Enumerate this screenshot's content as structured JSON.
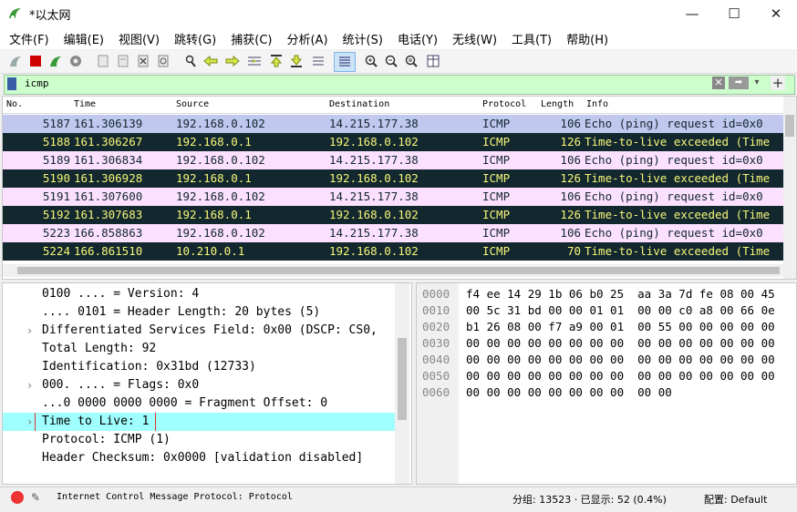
{
  "window": {
    "title": "*以太网",
    "buttons": [
      "—",
      "☐",
      "✕"
    ]
  },
  "menu": [
    "文件(F)",
    "编辑(E)",
    "视图(V)",
    "跳转(G)",
    "捕获(C)",
    "分析(A)",
    "统计(S)",
    "电话(Y)",
    "无线(W)",
    "工具(T)",
    "帮助(H)"
  ],
  "toolbar_icons": [
    "shark-fin-start-icon",
    "stop-icon",
    "restart-icon",
    "options-gear-icon",
    "open-file-icon",
    "save-file-icon",
    "close-file-icon",
    "reload-icon",
    "find-icon",
    "go-back-icon",
    "go-forward-icon",
    "go-to-packet-icon",
    "first-packet-icon",
    "last-packet-icon",
    "autoscroll-icon",
    "colorize-icon",
    "zoom-in-icon",
    "zoom-out-icon",
    "zoom-normal-icon",
    "resize-columns-icon"
  ],
  "filter": {
    "value": "icmp"
  },
  "packet_list": {
    "columns": [
      "No.",
      "Time",
      "Source",
      "Destination",
      "Protocol",
      "Length",
      "Info"
    ],
    "rows": [
      {
        "no": "5187",
        "time": "161.306139",
        "src": "192.168.0.102",
        "dst": "14.215.177.38",
        "proto": "ICMP",
        "len": "106",
        "info": "Echo (ping) request  id=0x0",
        "style": "selected"
      },
      {
        "no": "5188",
        "time": "161.306267",
        "src": "192.168.0.1",
        "dst": "192.168.0.102",
        "proto": "ICMP",
        "len": "126",
        "info": "Time-to-live exceeded (Time",
        "style": "ttl"
      },
      {
        "no": "5189",
        "time": "161.306834",
        "src": "192.168.0.102",
        "dst": "14.215.177.38",
        "proto": "ICMP",
        "len": "106",
        "info": "Echo (ping) request  id=0x0",
        "style": "request"
      },
      {
        "no": "5190",
        "time": "161.306928",
        "src": "192.168.0.1",
        "dst": "192.168.0.102",
        "proto": "ICMP",
        "len": "126",
        "info": "Time-to-live exceeded (Time",
        "style": "ttl"
      },
      {
        "no": "5191",
        "time": "161.307600",
        "src": "192.168.0.102",
        "dst": "14.215.177.38",
        "proto": "ICMP",
        "len": "106",
        "info": "Echo (ping) request  id=0x0",
        "style": "request"
      },
      {
        "no": "5192",
        "time": "161.307683",
        "src": "192.168.0.1",
        "dst": "192.168.0.102",
        "proto": "ICMP",
        "len": "126",
        "info": "Time-to-live exceeded (Time",
        "style": "ttl"
      },
      {
        "no": "5223",
        "time": "166.858863",
        "src": "192.168.0.102",
        "dst": "14.215.177.38",
        "proto": "ICMP",
        "len": "106",
        "info": "Echo (ping) request  id=0x0",
        "style": "request"
      },
      {
        "no": "5224",
        "time": "166.861510",
        "src": "10.210.0.1",
        "dst": "192.168.0.102",
        "proto": "ICMP",
        "len": "70",
        "info": "Time-to-live exceeded (Time",
        "style": "ttl"
      }
    ]
  },
  "details": [
    {
      "text": "0100 .... = Version: 4",
      "expandable": false
    },
    {
      "text": ".... 0101 = Header Length: 20 bytes (5)",
      "expandable": false
    },
    {
      "text": "Differentiated Services Field: 0x00 (DSCP: CS0,",
      "expandable": true
    },
    {
      "text": "Total Length: 92",
      "expandable": false
    },
    {
      "text": "Identification: 0x31bd (12733)",
      "expandable": false
    },
    {
      "text": "000. .... = Flags: 0x0",
      "expandable": true
    },
    {
      "text": "...0 0000 0000 0000 = Fragment Offset: 0",
      "expandable": false
    },
    {
      "text": "Time to Live: 1",
      "expandable": true,
      "highlighted": true
    },
    {
      "text": "Protocol: ICMP (1)",
      "expandable": false
    },
    {
      "text": "Header Checksum: 0x0000 [validation disabled]",
      "expandable": false
    }
  ],
  "hex": {
    "offsets": [
      "0000",
      "0010",
      "0020",
      "0030",
      "0040",
      "0050",
      "0060"
    ],
    "lines": [
      "f4 ee 14 29 1b 06 b0 25  aa 3a 7d fe 08 00 45",
      "00 5c 31 bd 00 00 01 01  00 00 c0 a8 00 66 0e",
      "b1 26 08 00 f7 a9 00 01  00 55 00 00 00 00 00",
      "00 00 00 00 00 00 00 00  00 00 00 00 00 00 00",
      "00 00 00 00 00 00 00 00  00 00 00 00 00 00 00",
      "00 00 00 00 00 00 00 00  00 00 00 00 00 00 00",
      "00 00 00 00 00 00 00 00  00 00"
    ]
  },
  "status": {
    "protocol_text": "Internet Control Message Protocol: Protocol",
    "packets": "分组: 13523 · 已显示: 52 (0.4%)",
    "profile": "配置: Default"
  },
  "colors": {
    "selected": "#c0c8f0",
    "request": "#fce0ff",
    "ttl_bg": "#12272e",
    "ttl_fg": "#f7f779",
    "filter_bg": "#ccffcc",
    "highlight": "#a0ffff"
  }
}
